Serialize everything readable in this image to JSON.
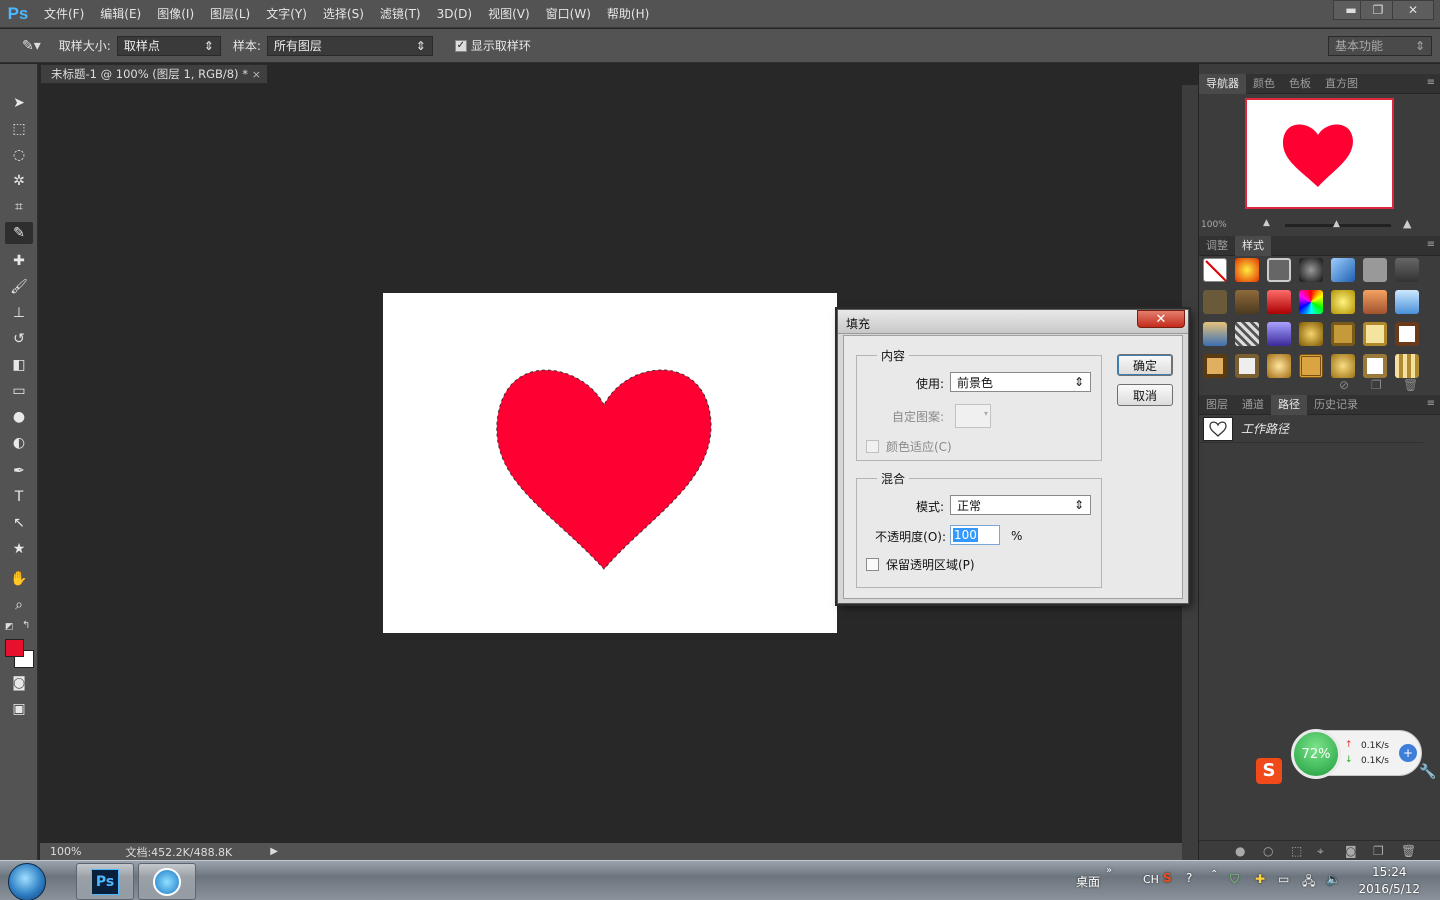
{
  "app": {
    "logo": "Ps"
  },
  "menu": [
    "文件(F)",
    "编辑(E)",
    "图像(I)",
    "图层(L)",
    "文字(Y)",
    "选择(S)",
    "滤镜(T)",
    "3D(D)",
    "视图(V)",
    "窗口(W)",
    "帮助(H)"
  ],
  "window_controls": {
    "minimize": "▬",
    "restore": "❐",
    "close": "✕"
  },
  "options": {
    "sample_size_label": "取样大小:",
    "sample_size_value": "取样点",
    "sample_label": "样本:",
    "sample_value": "所有图层",
    "show_ring_label": "显示取样环",
    "show_ring_checked": true,
    "workspace": "基本功能"
  },
  "document_tab": {
    "title": "未标题-1 @ 100% (图层 1, RGB/8) *",
    "close": "×"
  },
  "status": {
    "zoom": "100%",
    "doc_info": "文档:452.2K/488.8K"
  },
  "navigator": {
    "tabs": [
      "导航器",
      "颜色",
      "色板",
      "直方图"
    ],
    "zoom": "100%"
  },
  "styles_panel": {
    "tabs": [
      "调整",
      "样式"
    ]
  },
  "paths_panel": {
    "tabs": [
      "图层",
      "通道",
      "路径",
      "历史记录"
    ],
    "active_tab": "路径",
    "items": [
      {
        "label": "工作路径"
      }
    ]
  },
  "fill_dialog": {
    "title": "填充",
    "close": "✕",
    "contents_group": "内容",
    "use_label": "使用:",
    "use_value": "前景色",
    "custom_pattern_label": "自定图案:",
    "color_adapt_label": "颜色适应(C)",
    "blending_group": "混合",
    "mode_label": "模式:",
    "mode_value": "正常",
    "opacity_label": "不透明度(O):",
    "opacity_value": "100",
    "opacity_unit": "%",
    "preserve_label": "保留透明区域(P)",
    "ok": "确定",
    "cancel": "取消"
  },
  "colors": {
    "foreground": "#e8112d",
    "background": "#ffffff",
    "heart": "#ff0033"
  },
  "net_widget": {
    "percent": "72%",
    "up": "0.1K/s",
    "down": "0.1K/s"
  },
  "taskbar": {
    "desktop_label": "桌面",
    "ime": "CH",
    "time": "15:24",
    "date": "2016/5/12"
  }
}
